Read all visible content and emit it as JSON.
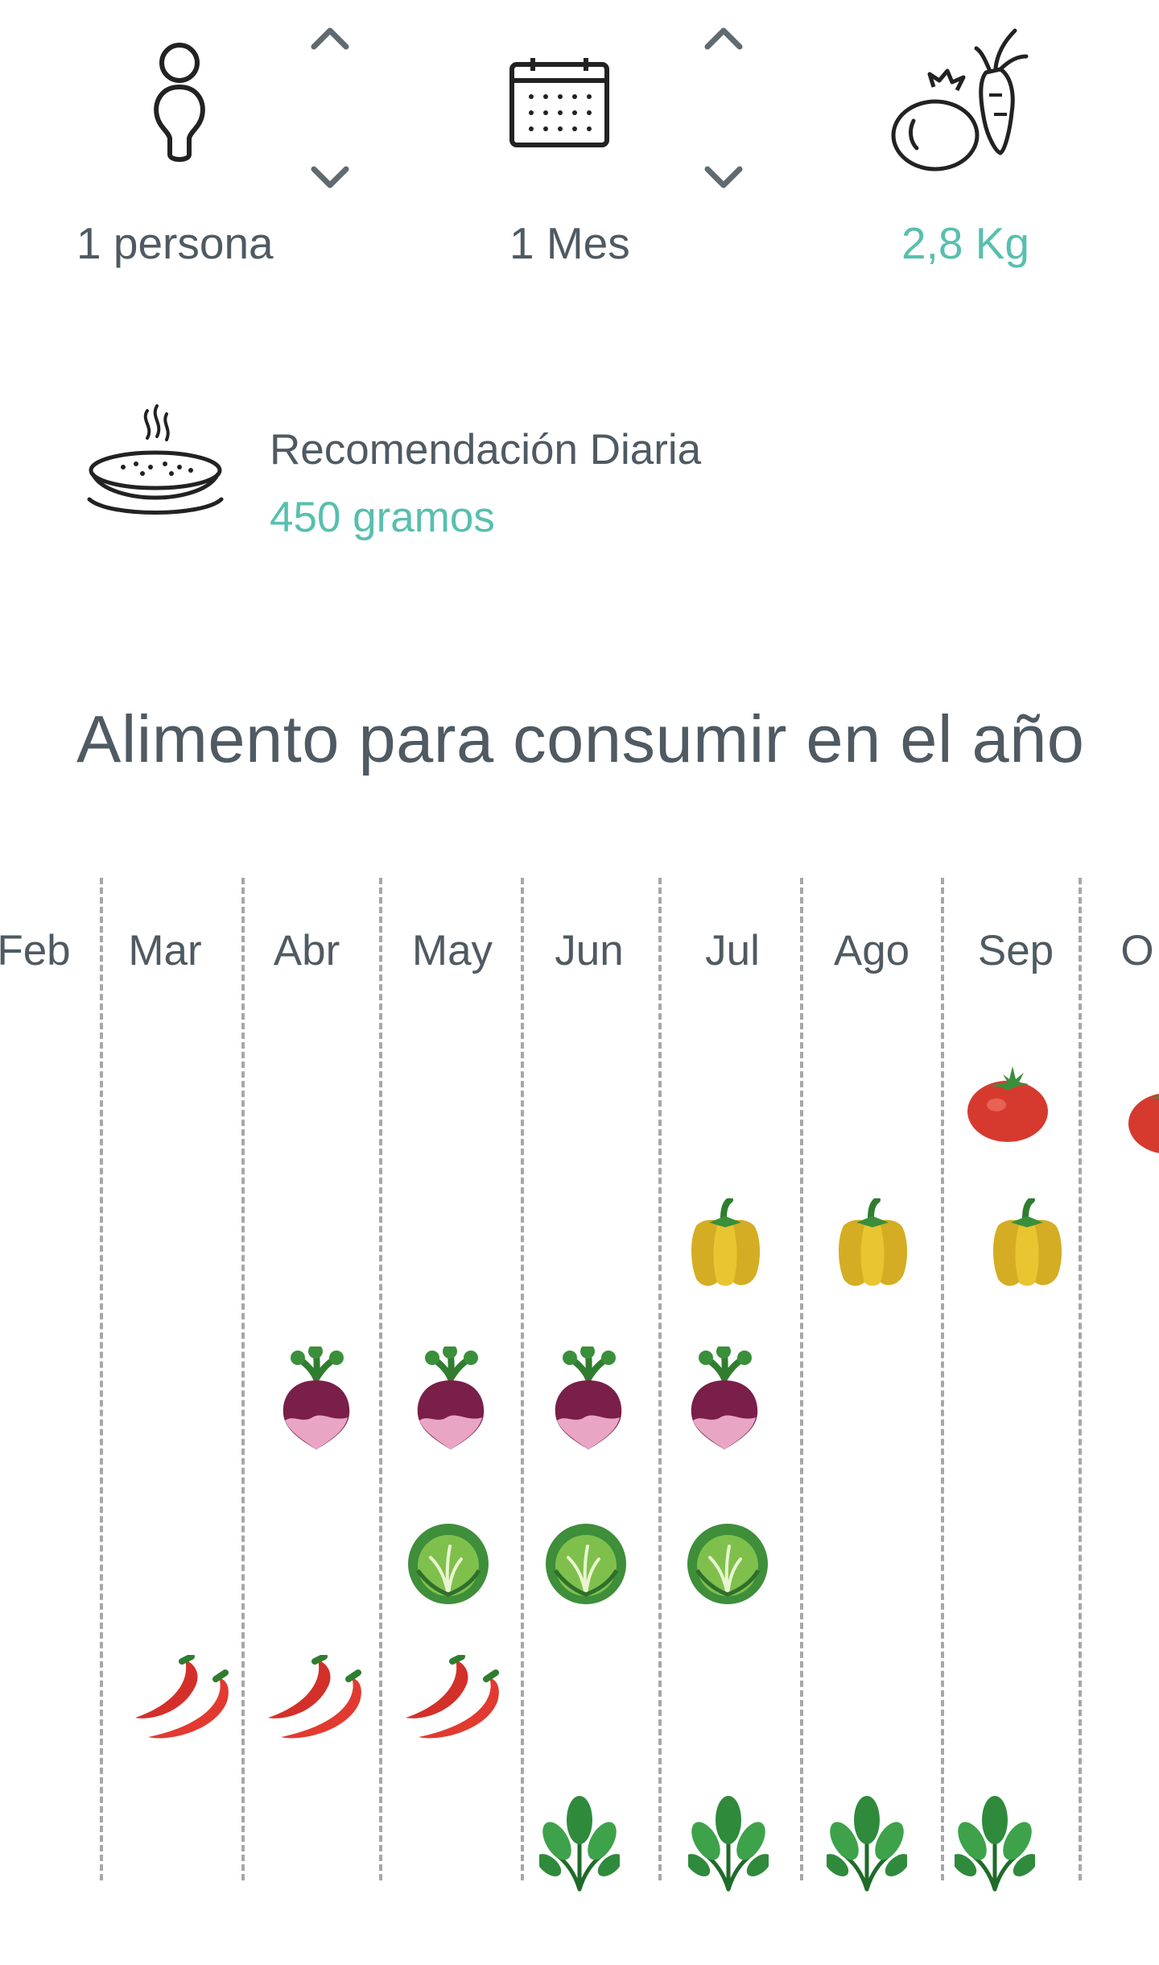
{
  "stats": {
    "people": {
      "label": "1 persona",
      "icon": "person-icon"
    },
    "period": {
      "label": "1 Mes",
      "icon": "calendar-icon"
    },
    "weight": {
      "label": "2,8 Kg",
      "icon": "vegetables-icon"
    }
  },
  "recommendation": {
    "title": "Recomendación Diaria",
    "value": "450 gramos",
    "icon": "dish-icon"
  },
  "section_title": "Alimento para consumir en el año",
  "calendar": {
    "months": [
      "Feb",
      "Mar",
      "Abr",
      "May",
      "Jun",
      "Jul",
      "Ago",
      "Sep",
      "O"
    ],
    "rows": [
      {
        "food": "tomato",
        "months": [
          "Sep",
          "O"
        ]
      },
      {
        "food": "yellow-pepper",
        "months": [
          "Jul",
          "Ago",
          "Sep"
        ]
      },
      {
        "food": "beet",
        "months": [
          "Abr",
          "May",
          "Jun",
          "Jul"
        ]
      },
      {
        "food": "cabbage",
        "months": [
          "May",
          "Jun",
          "Jul"
        ]
      },
      {
        "food": "chili",
        "months": [
          "Mar",
          "Abr",
          "May"
        ]
      },
      {
        "food": "spinach",
        "months": [
          "Jun",
          "Jul",
          "Ago",
          "Sep"
        ]
      }
    ]
  },
  "colors": {
    "text": "#4f5a62",
    "accent": "#58bfae",
    "divider": "#a7a7a7"
  }
}
